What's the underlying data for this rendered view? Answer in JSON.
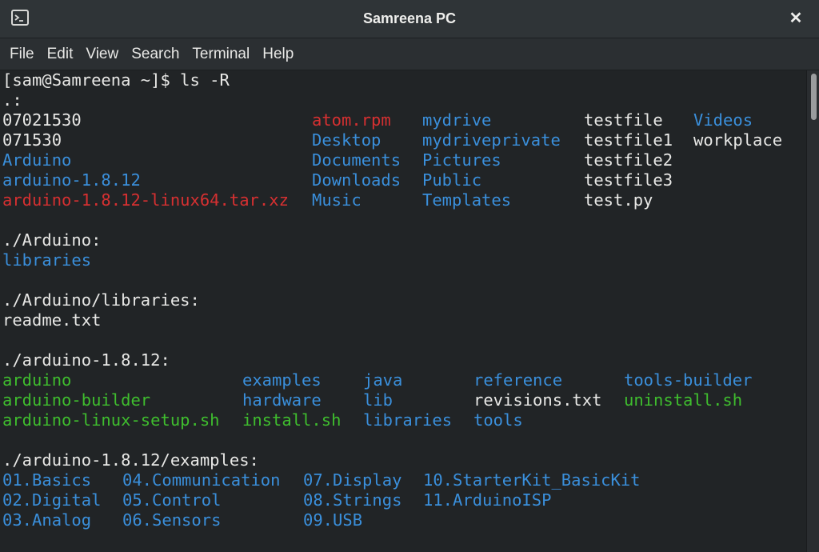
{
  "window": {
    "title": "Samreena PC",
    "close_label": "✕"
  },
  "menu": [
    "File",
    "Edit",
    "View",
    "Search",
    "Terminal",
    "Help"
  ],
  "colors": {
    "directory": "#3a8fdb",
    "archive": "#d63031",
    "executable": "#3fbd2e",
    "plain": "#e8e8e6"
  },
  "terminal": {
    "prompt": "[sam@Samreena ~]$ ls -R",
    "lines": [
      {
        "text": ".:"
      },
      {
        "items": [
          {
            "text": "07021530",
            "kind": "plain"
          },
          {
            "text": "atom.rpm",
            "kind": "archive"
          },
          {
            "text": "mydrive",
            "kind": "directory"
          },
          {
            "text": "testfile",
            "kind": "plain"
          },
          {
            "text": "Videos",
            "kind": "directory"
          }
        ]
      },
      {
        "items": [
          {
            "text": "071530",
            "kind": "plain"
          },
          {
            "text": "Desktop",
            "kind": "directory"
          },
          {
            "text": "mydriveprivate",
            "kind": "directory"
          },
          {
            "text": "testfile1",
            "kind": "plain"
          },
          {
            "text": "workplace",
            "kind": "plain"
          }
        ]
      },
      {
        "items": [
          {
            "text": "Arduino",
            "kind": "directory"
          },
          {
            "text": "Documents",
            "kind": "directory"
          },
          {
            "text": "Pictures",
            "kind": "directory"
          },
          {
            "text": "testfile2",
            "kind": "plain"
          }
        ]
      },
      {
        "items": [
          {
            "text": "arduino-1.8.12",
            "kind": "directory"
          },
          {
            "text": "Downloads",
            "kind": "directory"
          },
          {
            "text": "Public",
            "kind": "directory"
          },
          {
            "text": "testfile3",
            "kind": "plain"
          }
        ]
      },
      {
        "items": [
          {
            "text": "arduino-1.8.12-linux64.tar.xz",
            "kind": "archive"
          },
          {
            "text": "Music",
            "kind": "directory"
          },
          {
            "text": "Templates",
            "kind": "directory"
          },
          {
            "text": "test.py",
            "kind": "plain"
          }
        ]
      },
      {
        "text": ""
      },
      {
        "text": "./Arduino:"
      },
      {
        "items": [
          {
            "text": "libraries",
            "kind": "directory"
          }
        ]
      },
      {
        "text": ""
      },
      {
        "text": "./Arduino/libraries:"
      },
      {
        "items": [
          {
            "text": "readme.txt",
            "kind": "plain"
          }
        ]
      },
      {
        "text": ""
      },
      {
        "text": "./arduino-1.8.12:"
      },
      {
        "items": [
          {
            "text": "arduino",
            "kind": "executable"
          },
          {
            "text": "examples",
            "kind": "directory"
          },
          {
            "text": "java",
            "kind": "directory"
          },
          {
            "text": "reference",
            "kind": "directory"
          },
          {
            "text": "tools-builder",
            "kind": "directory"
          }
        ]
      },
      {
        "items": [
          {
            "text": "arduino-builder",
            "kind": "executable"
          },
          {
            "text": "hardware",
            "kind": "directory"
          },
          {
            "text": "lib",
            "kind": "directory"
          },
          {
            "text": "revisions.txt",
            "kind": "plain"
          },
          {
            "text": "uninstall.sh",
            "kind": "executable"
          }
        ]
      },
      {
        "items": [
          {
            "text": "arduino-linux-setup.sh",
            "kind": "executable"
          },
          {
            "text": "install.sh",
            "kind": "executable"
          },
          {
            "text": "libraries",
            "kind": "directory"
          },
          {
            "text": "tools",
            "kind": "directory"
          }
        ]
      },
      {
        "text": ""
      },
      {
        "text": "./arduino-1.8.12/examples:"
      },
      {
        "items": [
          {
            "text": "01.Basics",
            "kind": "directory"
          },
          {
            "text": "04.Communication",
            "kind": "directory"
          },
          {
            "text": "07.Display",
            "kind": "directory"
          },
          {
            "text": "10.StarterKit_BasicKit",
            "kind": "directory"
          }
        ]
      },
      {
        "items": [
          {
            "text": "02.Digital",
            "kind": "directory"
          },
          {
            "text": "05.Control",
            "kind": "directory"
          },
          {
            "text": "08.Strings",
            "kind": "directory"
          },
          {
            "text": "11.ArduinoISP",
            "kind": "directory"
          }
        ]
      },
      {
        "items": [
          {
            "text": "03.Analog",
            "kind": "directory"
          },
          {
            "text": "06.Sensors",
            "kind": "directory"
          },
          {
            "text": "09.USB",
            "kind": "directory"
          }
        ]
      }
    ]
  }
}
